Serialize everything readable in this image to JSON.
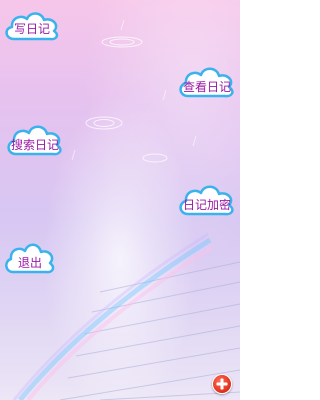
{
  "menu": {
    "write_diary": "写日记",
    "view_diary": "查看日记",
    "search_diary": "搜索日记",
    "encrypt_diary": "日记加密",
    "exit": "退出"
  },
  "colors": {
    "cloud_fill": "#ffffff",
    "cloud_outline": "#3ab2ec",
    "label_text": "#9b1aa6",
    "add_button": "#e2321f"
  },
  "icons": {
    "add": "plus-icon"
  }
}
